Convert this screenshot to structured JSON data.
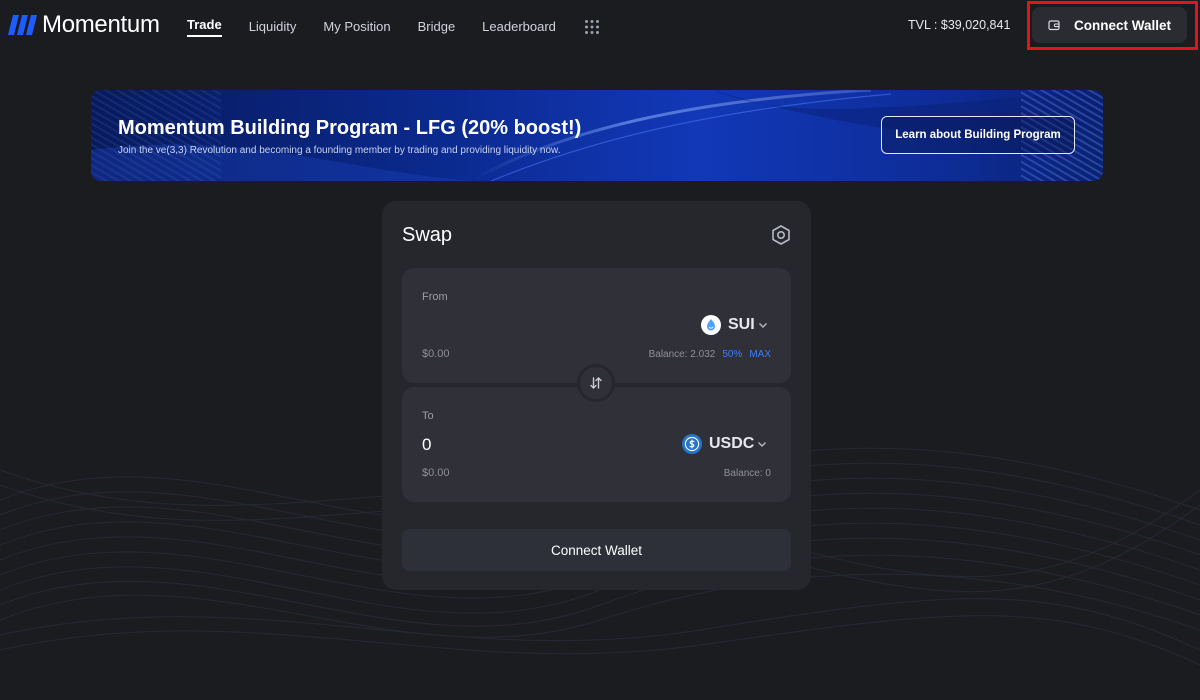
{
  "brand": {
    "name": "Momentum",
    "logo_icon": "momentum-logo-icon",
    "accent": "#1f5cff"
  },
  "nav": {
    "items": [
      {
        "label": "Trade",
        "active": true
      },
      {
        "label": "Liquidity",
        "active": false
      },
      {
        "label": "My Position",
        "active": false
      },
      {
        "label": "Bridge",
        "active": false
      },
      {
        "label": "Leaderboard",
        "active": false
      }
    ],
    "more_icon": "grid-dots-icon"
  },
  "tvl": {
    "text": "TVL : $39,020,841"
  },
  "header_wallet": {
    "label": "Connect Wallet",
    "icon": "wallet-icon",
    "highlight_color": "#e0161c"
  },
  "banner": {
    "title": "Momentum Building Program - LFG (20% boost!)",
    "subtitle": "Join the ve(3,3) Revolution and becoming a founding member by trading and providing liquidity now.",
    "button_label": "Learn about Building Program"
  },
  "swap": {
    "title": "Swap",
    "settings_icon": "settings-hexagon-icon",
    "from": {
      "label": "From",
      "amount_placeholder": "",
      "token": "SUI",
      "token_icon": "sui-icon",
      "usd_value": "$0.00",
      "balance": "Balance: 2.032",
      "half_label": "50%",
      "max_label": "MAX"
    },
    "switch_icon": "swap-arrows-icon",
    "to": {
      "label": "To",
      "amount": "0",
      "token": "USDC",
      "token_icon": "usdc-icon",
      "usd_value": "$0.00",
      "balance": "Balance: 0"
    },
    "connect_label": "Connect Wallet"
  },
  "colors": {
    "background": "#1b1c20",
    "card": "#26272d",
    "panel": "#303138",
    "link_blue": "#3d7bff"
  }
}
